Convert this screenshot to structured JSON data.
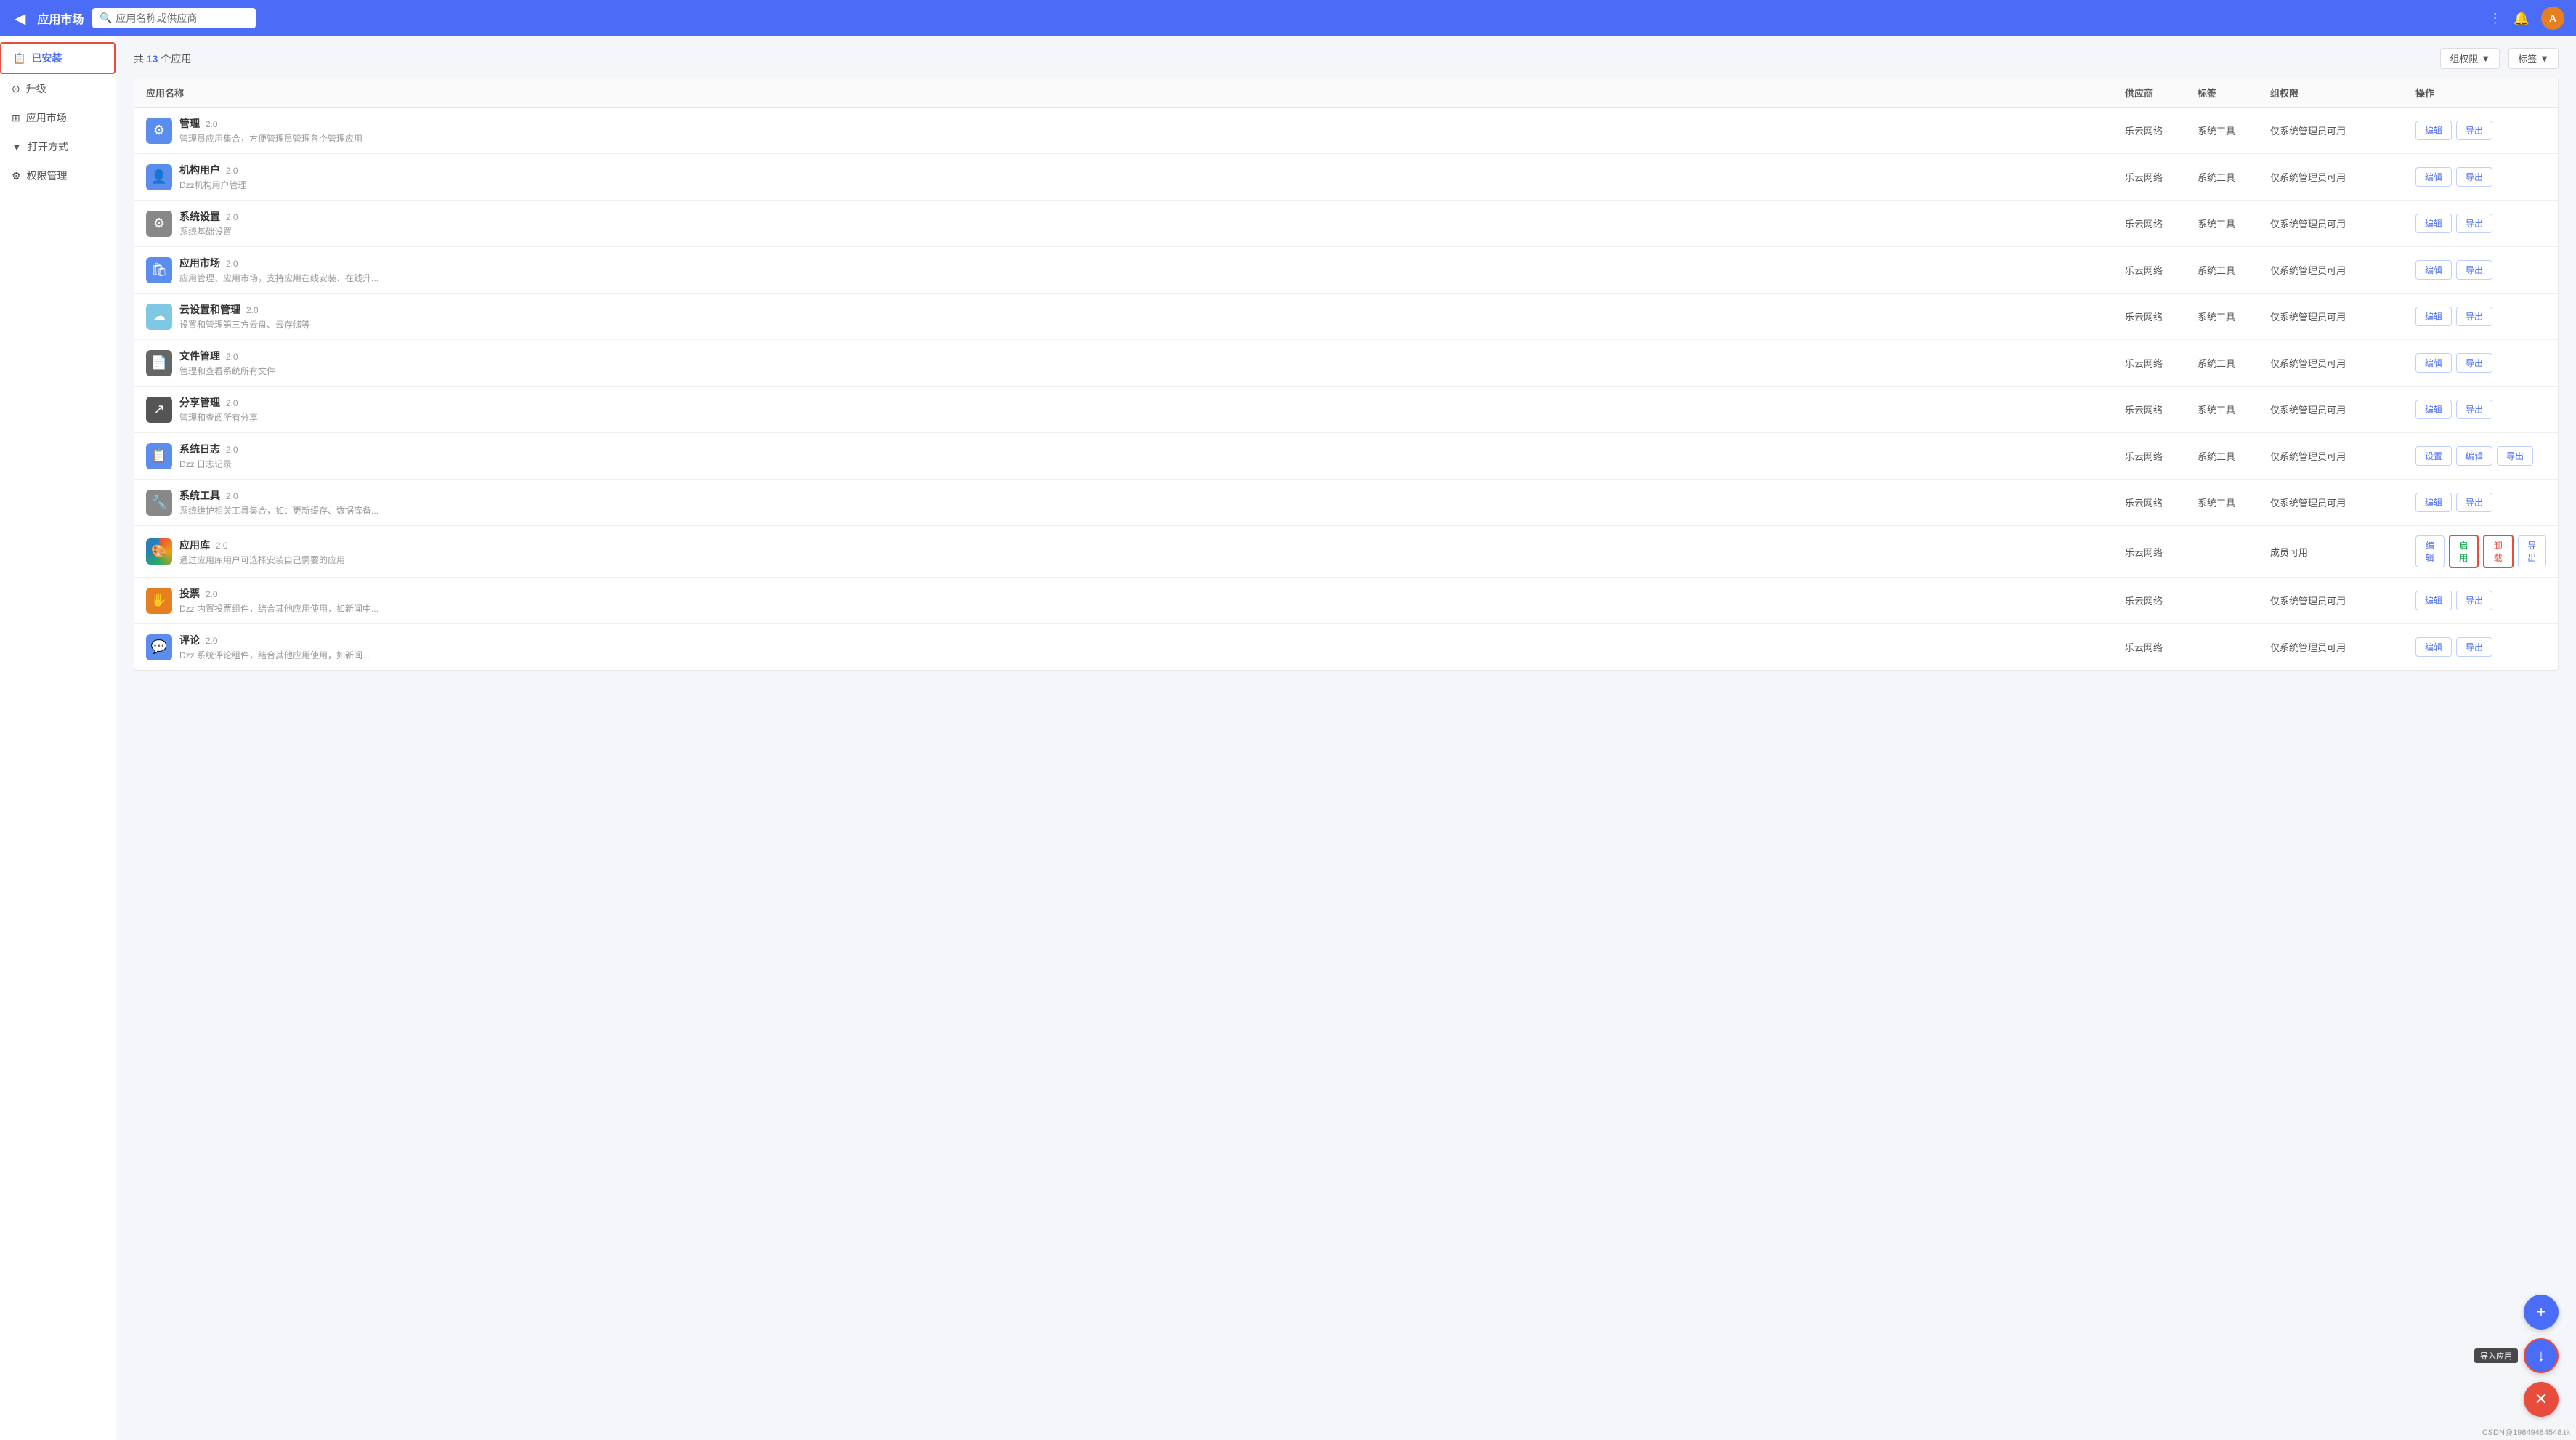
{
  "header": {
    "back_icon": "◀",
    "title": "应用市场",
    "search_placeholder": "应用名称或供应商",
    "grid_icon": "⠿",
    "bell_icon": "🔔",
    "avatar_text": "A"
  },
  "sidebar": {
    "items": [
      {
        "id": "installed",
        "icon": "📋",
        "label": "已安装",
        "active": true
      },
      {
        "id": "upgrade",
        "icon": "⊙",
        "label": "升级",
        "active": false
      },
      {
        "id": "market",
        "icon": "⊞",
        "label": "应用市场",
        "active": false
      },
      {
        "id": "open-mode",
        "icon": "▼",
        "label": "打开方式",
        "active": false
      },
      {
        "id": "permission",
        "icon": "⚙",
        "label": "权限管理",
        "active": false
      }
    ]
  },
  "toolbar": {
    "total_prefix": "共",
    "total_count": "13",
    "total_suffix": "个应用",
    "filter_group": "组权限",
    "filter_tag": "标签",
    "filter_arrow": "▼"
  },
  "table": {
    "headers": [
      "应用名称",
      "供应商",
      "标签",
      "组权限",
      "操作"
    ],
    "rows": [
      {
        "icon": "⚙",
        "icon_bg": "#5b8def",
        "icon_color": "#fff",
        "name": "管理",
        "version": "2.0",
        "desc": "管理员应用集合，方便管理员管理各个管理应用",
        "vendor": "乐云网络",
        "tag": "系统工具",
        "permission": "仅系统管理员可用",
        "actions": [
          "编辑",
          "导出"
        ]
      },
      {
        "icon": "👤",
        "icon_bg": "#5b8def",
        "icon_color": "#fff",
        "name": "机构用户",
        "version": "2.0",
        "desc": "Dzz机构用户管理",
        "vendor": "乐云网络",
        "tag": "系统工具",
        "permission": "仅系统管理员可用",
        "actions": [
          "编辑",
          "导出"
        ]
      },
      {
        "icon": "⚙",
        "icon_bg": "#888",
        "icon_color": "#fff",
        "name": "系统设置",
        "version": "2.0",
        "desc": "系统基础设置",
        "vendor": "乐云网络",
        "tag": "系统工具",
        "permission": "仅系统管理员可用",
        "actions": [
          "编辑",
          "导出"
        ]
      },
      {
        "icon": "🏪",
        "icon_bg": "#5b8def",
        "icon_color": "#fff",
        "name": "应用市场",
        "version": "2.0",
        "desc": "应用管理、应用市场，支持应用在线安装、在线升...",
        "vendor": "乐云网络",
        "tag": "系统工具",
        "permission": "仅系统管理员可用",
        "actions": [
          "编辑",
          "导出"
        ]
      },
      {
        "icon": "☁",
        "icon_bg": "#7ec8e3",
        "icon_color": "#fff",
        "name": "云设置和管理",
        "version": "2.0",
        "desc": "设置和管理第三方云盘、云存储等",
        "vendor": "乐云网络",
        "tag": "系统工具",
        "permission": "仅系统管理员可用",
        "actions": [
          "编辑",
          "导出"
        ]
      },
      {
        "icon": "📄",
        "icon_bg": "#666",
        "icon_color": "#fff",
        "name": "文件管理",
        "version": "2.0",
        "desc": "管理和查看系统所有文件",
        "vendor": "乐云网络",
        "tag": "系统工具",
        "permission": "仅系统管理员可用",
        "actions": [
          "编辑",
          "导出"
        ]
      },
      {
        "icon": "↗",
        "icon_bg": "#555",
        "icon_color": "#fff",
        "name": "分享管理",
        "version": "2.0",
        "desc": "管理和查阅所有分享",
        "vendor": "乐云网络",
        "tag": "系统工具",
        "permission": "仅系统管理员可用",
        "actions": [
          "编辑",
          "导出"
        ]
      },
      {
        "icon": "📋",
        "icon_bg": "#777",
        "icon_color": "#fff",
        "name": "系统日志",
        "version": "2.0",
        "desc": "Dzz 日志记录",
        "vendor": "乐云网络",
        "tag": "系统工具",
        "permission": "仅系统管理员可用",
        "actions": [
          "设置",
          "编辑",
          "导出"
        ]
      },
      {
        "icon": "🔧",
        "icon_bg": "#888",
        "icon_color": "#fff",
        "name": "系统工具",
        "version": "2.0",
        "desc": "系统维护相关工具集合，如：更新缓存、数据库备...",
        "vendor": "乐云网络",
        "tag": "系统工具",
        "permission": "仅系统管理员可用",
        "actions": [
          "编辑",
          "导出"
        ]
      },
      {
        "icon": "🎨",
        "icon_bg": "#fff",
        "icon_color": "#333",
        "is_colorful": true,
        "name": "应用库",
        "version": "2.0",
        "desc": "通过应用库用户可选择安装自己需要的应用",
        "vendor": "乐云网络",
        "tag": "",
        "permission": "成员可用",
        "actions": [
          "编辑",
          "启用",
          "卸载",
          "导出"
        ],
        "has_enable": true,
        "has_uninstall": true
      },
      {
        "icon": "✋",
        "icon_bg": "#e67e22",
        "icon_color": "#fff",
        "name": "投票",
        "version": "2.0",
        "desc": "Dzz 内置投票组件，结合其他应用使用，如新闻中...",
        "vendor": "乐云网络",
        "tag": "",
        "permission": "仅系统管理员可用",
        "actions": [
          "编辑",
          "导出"
        ]
      },
      {
        "icon": "💬",
        "icon_bg": "#5b8def",
        "icon_color": "#fff",
        "name": "评论",
        "version": "2.0",
        "desc": "Dzz 系统评论组件，结合其他应用使用，如新闻...",
        "vendor": "乐云网络",
        "tag": "",
        "permission": "仅系统管理员可用",
        "actions": [
          "编辑",
          "导出"
        ]
      }
    ]
  },
  "fab": {
    "add_icon": "+",
    "import_icon": "⬇",
    "import_label": "导入应用",
    "close_icon": "✕"
  },
  "status_bar": {
    "text": ""
  },
  "copyright": "CSDN@19849484548.tk"
}
